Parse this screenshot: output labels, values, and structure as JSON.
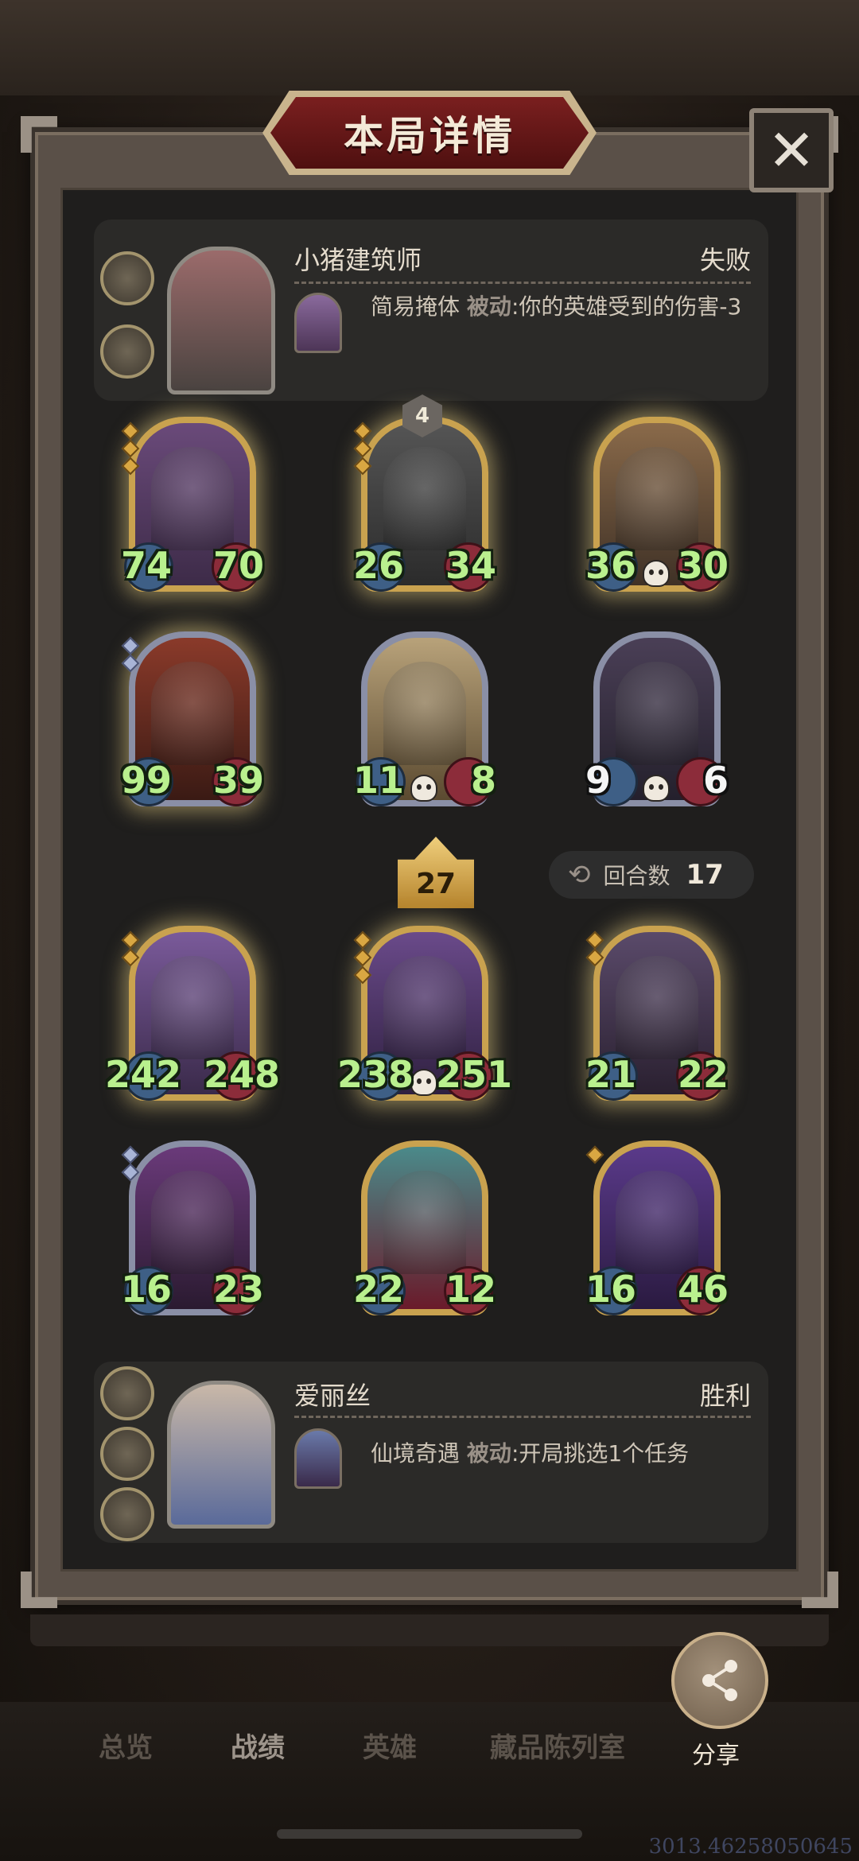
{
  "header": {
    "title": "本局详情"
  },
  "players": {
    "top": {
      "name": "小猪建筑师",
      "result": "失败",
      "ability_name": "简易掩体",
      "ability_type": "被动",
      "ability_desc": ":你的英雄受到的伤害-3"
    },
    "bottom": {
      "name": "爱丽丝",
      "result": "胜利",
      "ability_name": "仙境奇遇",
      "ability_type": "被动",
      "ability_desc": ":开局挑选1个任务"
    }
  },
  "opponent_board": [
    {
      "attack": "74",
      "health": "70"
    },
    {
      "attack": "26",
      "health": "34",
      "tier": "4"
    },
    {
      "attack": "36",
      "health": "30"
    },
    {
      "attack": "99",
      "health": "39"
    },
    {
      "attack": "11",
      "health": "8"
    },
    {
      "attack": "9",
      "health": "6"
    }
  ],
  "player_board": [
    {
      "attack": "242",
      "health": "248"
    },
    {
      "attack": "238",
      "health": "251"
    },
    {
      "attack": "21",
      "health": "22"
    },
    {
      "attack": "16",
      "health": "23"
    },
    {
      "attack": "22",
      "health": "12"
    },
    {
      "attack": "16",
      "health": "46"
    }
  ],
  "center": {
    "level": "27",
    "round_label": "回合数",
    "round_value": "17"
  },
  "tabs": [
    "总览",
    "战绩",
    "英雄",
    "藏品陈列室"
  ],
  "share": {
    "label": "分享"
  },
  "footer": {
    "coord": "3013.46258050645"
  },
  "colors": {
    "stat_green": "#b9f08e",
    "banner_red": "#7a1f1f",
    "gold_frame": "#c9a24f"
  },
  "icons": [
    "close-icon",
    "share-icon",
    "skull-icon",
    "round-icon"
  ]
}
